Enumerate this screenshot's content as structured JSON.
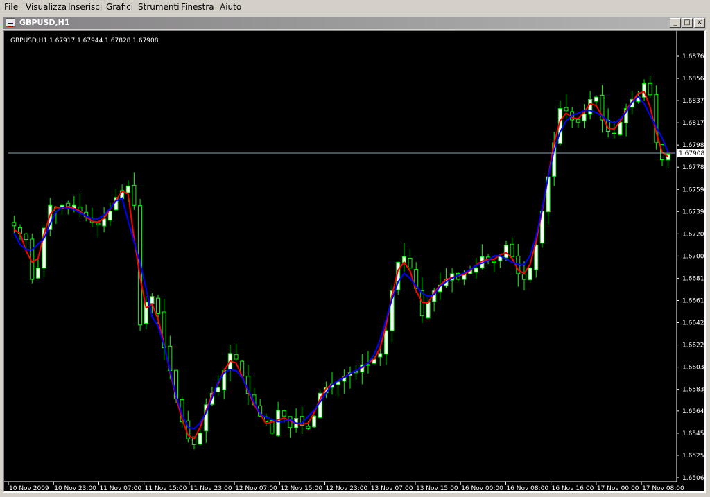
{
  "menu": {
    "items": [
      {
        "label": "File",
        "key": "F"
      },
      {
        "label": "Visualizza",
        "key": "V"
      },
      {
        "label": "Inserisci",
        "key": "I"
      },
      {
        "label": "Grafici",
        "key": "G"
      },
      {
        "label": "Strumenti",
        "key": "S"
      },
      {
        "label": "Finestra",
        "key": "F"
      },
      {
        "label": "Aiuto",
        "key": "A"
      }
    ]
  },
  "window": {
    "title": "GBPUSD,H1",
    "buttons": {
      "minimize": "_",
      "maximize": "□",
      "close": "×"
    }
  },
  "colors": {
    "background": "#000000",
    "bull_candle": "#ffffff",
    "wick": "#00ff00",
    "ma_red": "#ff0000",
    "ma_blue": "#0000ff",
    "bid_line": "#8fa9b5",
    "axis": "#ffffff"
  },
  "chart_data": {
    "type": "candlestick",
    "header": "GBPUSD,H1  1.67917 1.67944 1.67828 1.67908",
    "symbol": "GBPUSD",
    "timeframe": "H1",
    "ohlc_last": {
      "open": 1.67917,
      "high": 1.67944,
      "low": 1.67828,
      "close": 1.67908
    },
    "current_price_label": "1.67908",
    "current_price": 1.67908,
    "ylim": [
      1.6506,
      1.6883
    ],
    "price_ticks": [
      "1.68760",
      "1.68565",
      "1.68370",
      "1.68175",
      "1.67980",
      "1.67785",
      "1.67590",
      "1.67395",
      "1.67200",
      "1.67005",
      "1.66810",
      "1.66615",
      "1.66420",
      "1.66225",
      "1.66030",
      "1.65835",
      "1.65645",
      "1.65450",
      "1.65255",
      "1.65060"
    ],
    "time_ticks": [
      "10 Nov 2009",
      "10 Nov 23:00",
      "11 Nov 07:00",
      "11 Nov 15:00",
      "11 Nov 23:00",
      "12 Nov 07:00",
      "12 Nov 15:00",
      "12 Nov 23:00",
      "13 Nov 07:00",
      "13 Nov 15:00",
      "16 Nov 00:00",
      "16 Nov 08:00",
      "16 Nov 16:00",
      "17 Nov 00:00",
      "17 Nov 08:00"
    ],
    "close_series": [
      1.6727,
      1.672,
      1.6715,
      1.668,
      1.669,
      1.6725,
      1.6745,
      1.674,
      1.6745,
      1.6742,
      1.6745,
      1.674,
      1.6735,
      1.673,
      1.6728,
      1.6733,
      1.674,
      1.6752,
      1.6758,
      1.6762,
      1.6745,
      1.664,
      1.666,
      1.6665,
      1.665,
      1.662,
      1.66,
      1.6575,
      1.6555,
      1.654,
      1.6535,
      1.6545,
      1.657,
      1.658,
      1.6585,
      1.66,
      1.6615,
      1.661,
      1.6595,
      1.658,
      1.657,
      1.656,
      1.6555,
      1.6545,
      1.6565,
      1.656,
      1.655,
      1.6558,
      1.6552,
      1.6549,
      1.656,
      1.658,
      1.6585,
      1.6588,
      1.659,
      1.6595,
      1.6598,
      1.6598,
      1.6605,
      1.6605,
      1.661,
      1.6615,
      1.6635,
      1.667,
      1.6695,
      1.67,
      1.669,
      1.6672,
      1.6648,
      1.666,
      1.667,
      1.6675,
      1.668,
      1.6685,
      1.668,
      1.6685,
      1.6688,
      1.669,
      1.67,
      1.6698,
      1.6695,
      1.67,
      1.671,
      1.67,
      1.6685,
      1.668,
      1.669,
      1.671,
      1.674,
      1.677,
      1.68,
      1.683,
      1.6828,
      1.682,
      1.6818,
      1.6825,
      1.6838,
      1.684,
      1.682,
      1.681,
      1.6808,
      1.6818,
      1.683,
      1.6838,
      1.684,
      1.6852,
      1.6842,
      1.68,
      1.6785,
      1.679
    ]
  }
}
